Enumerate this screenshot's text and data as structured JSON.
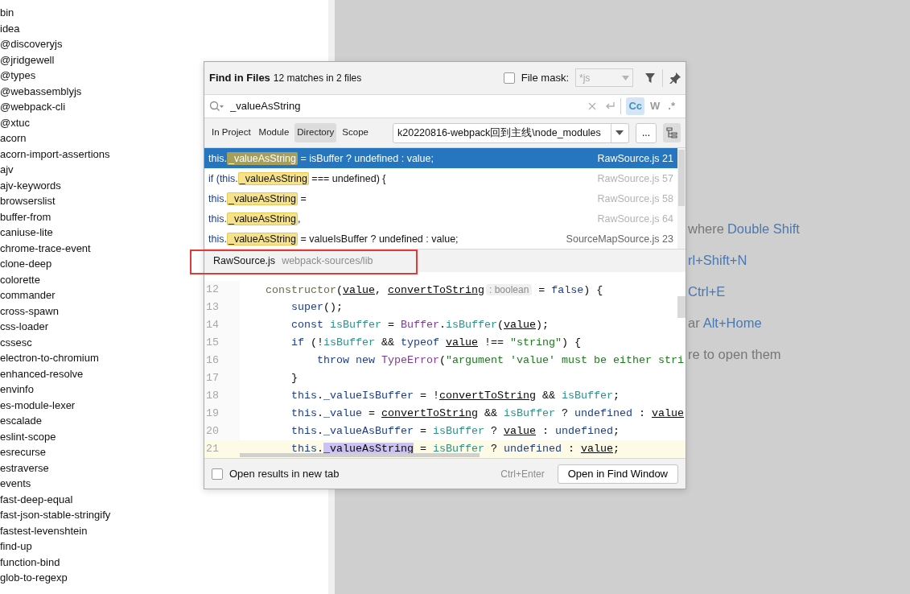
{
  "project_tree": {
    "items": [
      {
        "label": "bin"
      },
      {
        "label": "idea"
      },
      {
        "label": "@discoveryjs"
      },
      {
        "label": "@jridgewell"
      },
      {
        "label": "@types"
      },
      {
        "label": "@webassemblyjs"
      },
      {
        "label": "@webpack-cli"
      },
      {
        "label": "@xtuc"
      },
      {
        "label": "acorn"
      },
      {
        "label": "acorn-import-assertions"
      },
      {
        "label": "ajv"
      },
      {
        "label": "ajv-keywords"
      },
      {
        "label": "browserslist"
      },
      {
        "label": "buffer-from"
      },
      {
        "label": "caniuse-lite"
      },
      {
        "label": "chrome-trace-event"
      },
      {
        "label": "clone-deep"
      },
      {
        "label": "colorette"
      },
      {
        "label": "commander"
      },
      {
        "label": "cross-spawn"
      },
      {
        "label": "css-loader"
      },
      {
        "label": "cssesc"
      },
      {
        "label": "electron-to-chromium"
      },
      {
        "label": "enhanced-resolve"
      },
      {
        "label": "envinfo"
      },
      {
        "label": "es-module-lexer"
      },
      {
        "label": "escalade"
      },
      {
        "label": "eslint-scope"
      },
      {
        "label": "esrecurse"
      },
      {
        "label": "estraverse"
      },
      {
        "label": "events"
      },
      {
        "label": "fast-deep-equal"
      },
      {
        "label": "fast-json-stable-stringify"
      },
      {
        "label": "fastest-levenshtein"
      },
      {
        "label": "find-up"
      },
      {
        "label": "function-bind"
      },
      {
        "label": "glob-to-regexp"
      }
    ]
  },
  "editor_hints": [
    {
      "label": "where",
      "shortcut": "Double Shift"
    },
    {
      "shortcut": "rl+Shift+N"
    },
    {
      "shortcut": "Ctrl+E"
    },
    {
      "label": "ar",
      "shortcut": "Alt+Home"
    },
    {
      "label": "re to open them"
    }
  ],
  "find_dialog": {
    "title": "Find in Files",
    "summary": "12 matches in 2 files",
    "file_mask": {
      "label": "File mask:",
      "checked": false,
      "value": "*js",
      "disabled": true
    },
    "search": {
      "value": "_valueAsString"
    },
    "options": [
      {
        "label": "Cc",
        "selected": true
      },
      {
        "label": "W",
        "selected": false
      },
      {
        "label": ".*",
        "selected": false
      }
    ],
    "scopes": [
      {
        "label": "In Project",
        "selected": false
      },
      {
        "label": "Module",
        "selected": false
      },
      {
        "label": "Directory",
        "selected": true
      },
      {
        "label": "Scope",
        "selected": false
      }
    ],
    "directory": {
      "value": "k20220816-webpack回到主线\\node_modules"
    },
    "browse_button": "...",
    "results": [
      {
        "prefix": "this.",
        "match": "_valueAsString",
        "suffix": " = isBuffer ? undefined : value;",
        "file": "RawSource.js 21",
        "selected": true,
        "dimmed": false
      },
      {
        "prefix": "if (this.",
        "match": "_valueAsString",
        "suffix": " === undefined) {",
        "file": "RawSource.js 57",
        "selected": false,
        "dimmed": true
      },
      {
        "prefix": "this.",
        "match": "_valueAsString",
        "suffix": " =",
        "file": "RawSource.js 58",
        "selected": false,
        "dimmed": true
      },
      {
        "prefix": "this.",
        "match": "_valueAsString",
        "suffix": ",",
        "file": "RawSource.js 64",
        "selected": false,
        "dimmed": true
      },
      {
        "prefix": "this.",
        "match": "_valueAsString",
        "suffix": " = valueIsBuffer ? undefined : value;",
        "file": "SourceMapSource.js 23",
        "selected": false,
        "dimmed": false
      }
    ],
    "preview": {
      "file": "RawSource.js",
      "path": "webpack-sources/lib",
      "lines": [
        {
          "number": "12",
          "current": false,
          "tokens": [
            {
              "kind": "fn",
              "text": "    constructor"
            },
            {
              "kind": "plain",
              "text": "("
            },
            {
              "kind": "param",
              "text": "value"
            },
            {
              "kind": "plain",
              "text": ", "
            },
            {
              "kind": "param",
              "text": "convertToString"
            },
            {
              "kind": "hint",
              "text": ": boolean"
            },
            {
              "kind": "plain",
              "text": " = "
            },
            {
              "kind": "kw",
              "text": "false"
            },
            {
              "kind": "plain",
              "text": ") {"
            }
          ]
        },
        {
          "number": "13",
          "current": false,
          "tokens": [
            {
              "kind": "kw",
              "text": "        super"
            },
            {
              "kind": "plain",
              "text": "();"
            }
          ]
        },
        {
          "number": "14",
          "current": false,
          "tokens": [
            {
              "kind": "kw",
              "text": "        const "
            },
            {
              "kind": "local",
              "text": "isBuffer"
            },
            {
              "kind": "plain",
              "text": " = "
            },
            {
              "kind": "type",
              "text": "Buffer"
            },
            {
              "kind": "plain",
              "text": "."
            },
            {
              "kind": "local",
              "text": "isBuffer"
            },
            {
              "kind": "plain",
              "text": "("
            },
            {
              "kind": "param",
              "text": "value"
            },
            {
              "kind": "plain",
              "text": ");"
            }
          ]
        },
        {
          "number": "15",
          "current": false,
          "tokens": [
            {
              "kind": "kw",
              "text": "        if"
            },
            {
              "kind": "plain",
              "text": " (!"
            },
            {
              "kind": "local",
              "text": "isBuffer"
            },
            {
              "kind": "plain",
              "text": " && "
            },
            {
              "kind": "kw",
              "text": "typeof "
            },
            {
              "kind": "param",
              "text": "value"
            },
            {
              "kind": "plain",
              "text": " !== "
            },
            {
              "kind": "str",
              "text": "\"string\""
            },
            {
              "kind": "plain",
              "text": ") {"
            }
          ]
        },
        {
          "number": "16",
          "current": false,
          "tokens": [
            {
              "kind": "kw",
              "text": "            throw new "
            },
            {
              "kind": "type",
              "text": "TypeError"
            },
            {
              "kind": "plain",
              "text": "("
            },
            {
              "kind": "str",
              "text": "\"argument 'value' must be either stri"
            }
          ]
        },
        {
          "number": "17",
          "current": false,
          "tokens": [
            {
              "kind": "plain",
              "text": "        }"
            }
          ]
        },
        {
          "number": "18",
          "current": false,
          "tokens": [
            {
              "kind": "kw",
              "text": "        this"
            },
            {
              "kind": "plain",
              "text": "."
            },
            {
              "kind": "field",
              "text": "_valueIsBuffer"
            },
            {
              "kind": "plain",
              "text": " = !"
            },
            {
              "kind": "param",
              "text": "convertToString"
            },
            {
              "kind": "plain",
              "text": " && "
            },
            {
              "kind": "local",
              "text": "isBuffer"
            },
            {
              "kind": "plain",
              "text": ";"
            }
          ]
        },
        {
          "number": "19",
          "current": false,
          "tokens": [
            {
              "kind": "kw",
              "text": "        this"
            },
            {
              "kind": "plain",
              "text": "."
            },
            {
              "kind": "field",
              "text": "_value"
            },
            {
              "kind": "plain",
              "text": " = "
            },
            {
              "kind": "param",
              "text": "convertToString"
            },
            {
              "kind": "plain",
              "text": " && "
            },
            {
              "kind": "local",
              "text": "isBuffer"
            },
            {
              "kind": "plain",
              "text": " ? "
            },
            {
              "kind": "kw",
              "text": "undefined"
            },
            {
              "kind": "plain",
              "text": " : "
            },
            {
              "kind": "param",
              "text": "value"
            }
          ]
        },
        {
          "number": "20",
          "current": false,
          "tokens": [
            {
              "kind": "kw",
              "text": "        this"
            },
            {
              "kind": "plain",
              "text": "."
            },
            {
              "kind": "field",
              "text": "_valueAsBuffer"
            },
            {
              "kind": "plain",
              "text": " = "
            },
            {
              "kind": "local",
              "text": "isBuffer"
            },
            {
              "kind": "plain",
              "text": " ? "
            },
            {
              "kind": "param",
              "text": "value"
            },
            {
              "kind": "plain",
              "text": " : "
            },
            {
              "kind": "kw",
              "text": "undefined"
            },
            {
              "kind": "plain",
              "text": ";"
            }
          ]
        },
        {
          "number": "21",
          "current": true,
          "tokens": [
            {
              "kind": "kw",
              "text": "        this"
            },
            {
              "kind": "plain",
              "text": "."
            },
            {
              "kind": "match",
              "text": "_valueAsString"
            },
            {
              "kind": "plain",
              "text": " = "
            },
            {
              "kind": "local",
              "text": "isBuffer"
            },
            {
              "kind": "plain",
              "text": " ? "
            },
            {
              "kind": "kw",
              "text": "undefined"
            },
            {
              "kind": "plain",
              "text": " : "
            },
            {
              "kind": "param",
              "text": "value"
            },
            {
              "kind": "plain",
              "text": ";"
            }
          ]
        }
      ]
    },
    "new_tab": {
      "label": "Open results in new tab",
      "checked": false
    },
    "shortcut": "Ctrl+Enter",
    "open_button": "Open in Find Window"
  }
}
